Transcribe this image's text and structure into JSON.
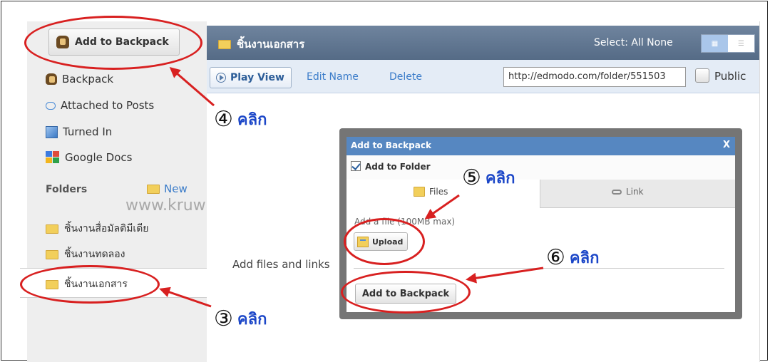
{
  "sidebar": {
    "add_button_label": "Add to Backpack",
    "items": [
      {
        "label": "Backpack",
        "icon": "backpack-icon"
      },
      {
        "label": "Attached to Posts",
        "icon": "comment-bubble-icon"
      },
      {
        "label": "Turned In",
        "icon": "turned-in-icon"
      },
      {
        "label": "Google Docs",
        "icon": "google-docs-icon"
      }
    ],
    "folders_label": "Folders",
    "new_label": "New",
    "folders": [
      {
        "label": "ชิ้นงานสื่อมัลติมีเดีย"
      },
      {
        "label": "ชิ้นงานทดลอง"
      },
      {
        "label": "ชิ้นงานเอกสาร",
        "selected": true
      }
    ]
  },
  "header": {
    "folder_title": "ชิ้นงานเอกสาร",
    "select_label": "Select: All None"
  },
  "toolbar": {
    "play_view": "Play View",
    "edit_name": "Edit Name",
    "delete": "Delete",
    "url": "http://edmodo.com/folder/551503",
    "public_label": "Public"
  },
  "main": {
    "empty_text": "Add files and links"
  },
  "modal": {
    "title": "Add to Backpack",
    "close": "X",
    "add_to_folder": "Add to Folder",
    "tab_files": "Files",
    "tab_link": "Link",
    "add_file_hint": "Add a file (100MB max)",
    "upload": "Upload",
    "submit": "Add to Backpack"
  },
  "watermark": "www.kruwandee.com",
  "annotations": [
    {
      "num": "④",
      "word": "คลิก"
    },
    {
      "num": "⑤",
      "word": "คลิก"
    },
    {
      "num": "⑥",
      "word": "คลิก"
    },
    {
      "num": "③",
      "word": "คลิก"
    }
  ],
  "colors": {
    "header_bar": "#5e7592",
    "modal_header": "#5687c1",
    "annotation_red": "#d82020",
    "annotation_blue": "#1c47c8",
    "link": "#3b7cc9"
  }
}
